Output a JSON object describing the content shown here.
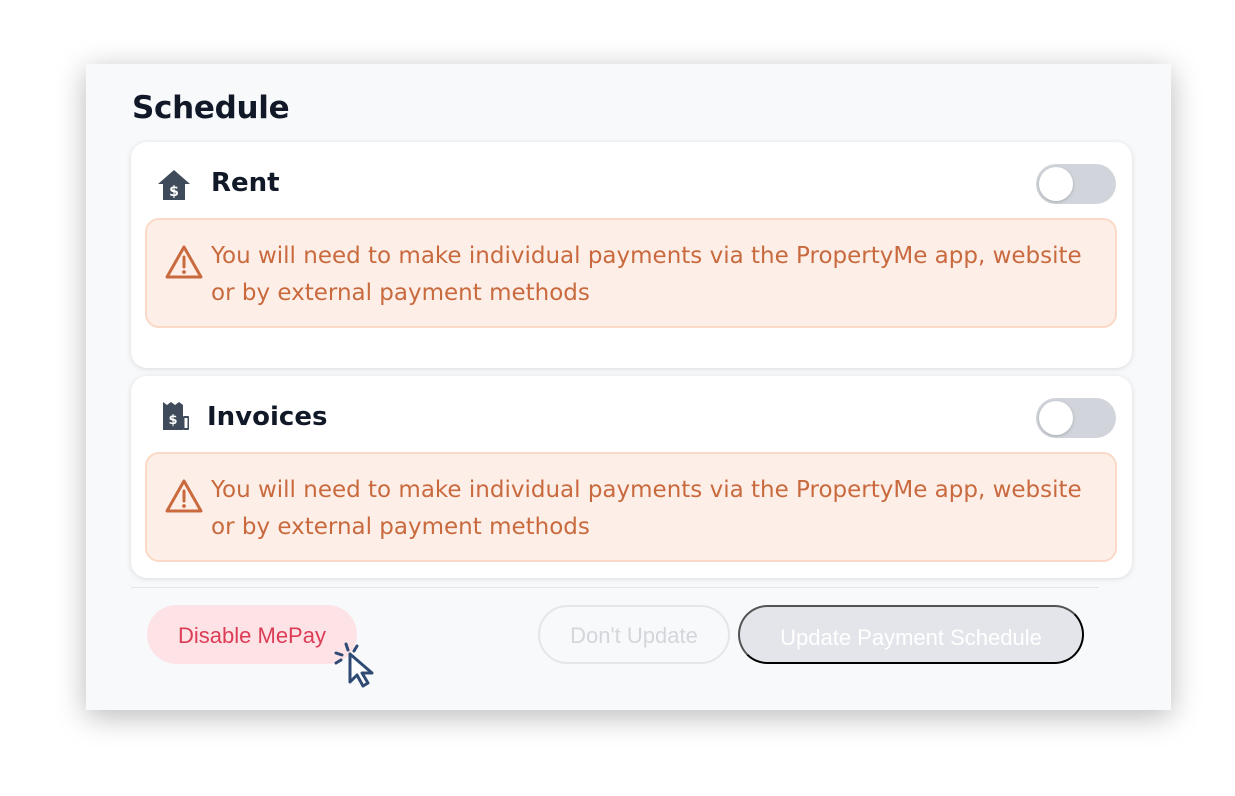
{
  "schedule": {
    "title": "Schedule"
  },
  "rent": {
    "icon": "house-dollar-icon",
    "title": "Rent",
    "toggle_on": false,
    "warning_icon": "warning-triangle-icon",
    "warning_text": "You will need to make individual payments via the PropertyMe app, website or by external payment methods"
  },
  "invoices": {
    "icon": "receipt-dollar-icon",
    "title": "Invoices",
    "toggle_on": false,
    "warning_icon": "warning-triangle-icon",
    "warning_text": "You will need to make individual payments via the PropertyMe app, website or by external payment methods"
  },
  "footer": {
    "disable_label": "Disable MePay",
    "dont_update_label": "Don't Update",
    "update_label": "Update Payment Schedule"
  },
  "colors": {
    "warning_text": "#c96a3e",
    "warning_bg": "#fdefe8",
    "danger": "#dc3c55",
    "toggle_off": "#d1d5db"
  },
  "cursor_icon": "pointer-click-cursor-icon"
}
